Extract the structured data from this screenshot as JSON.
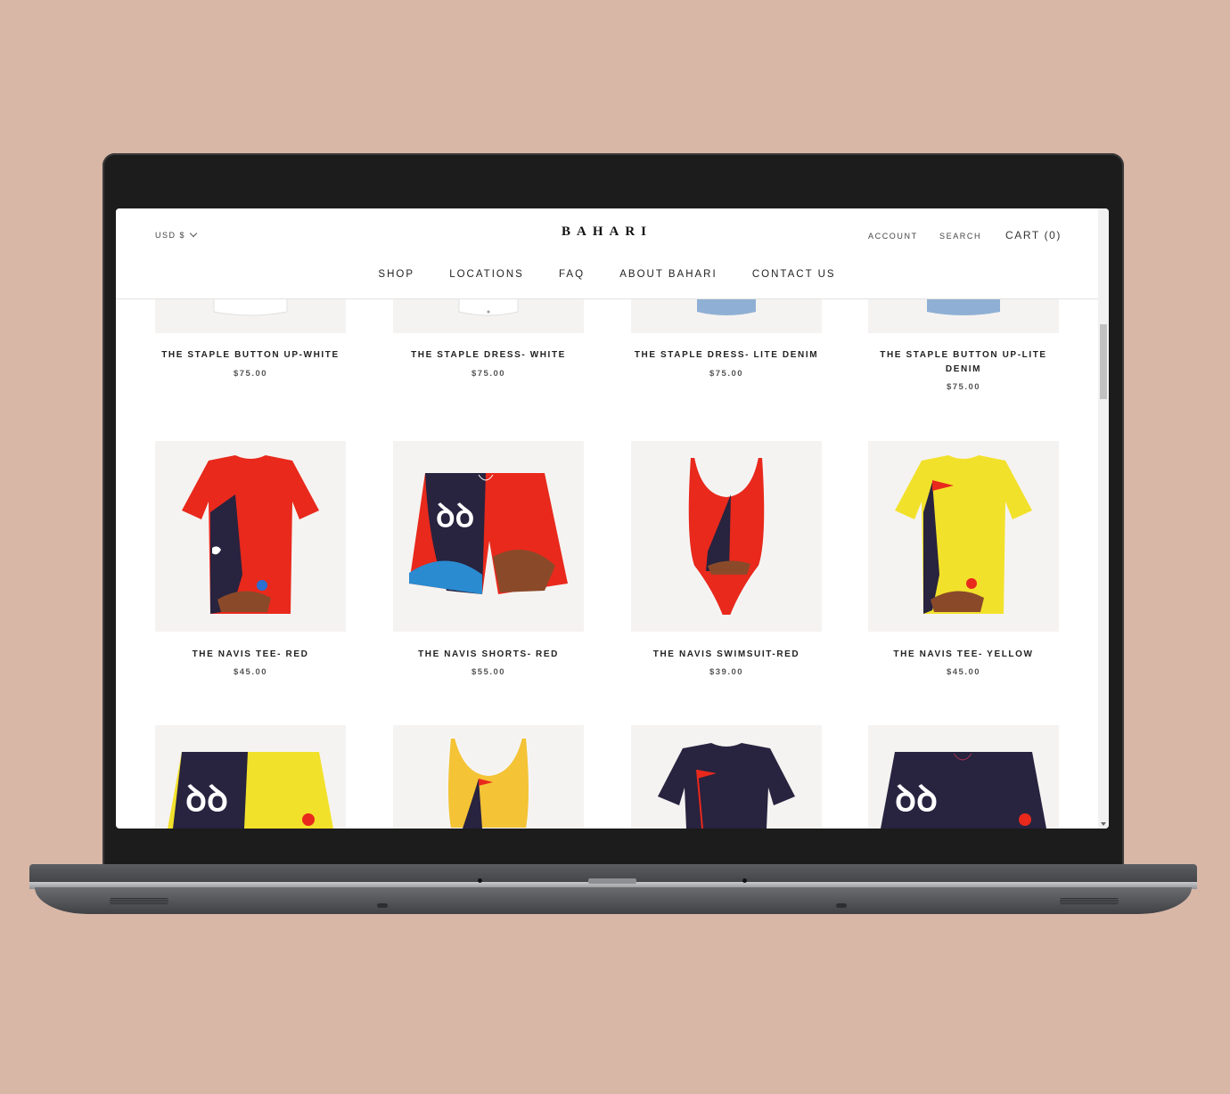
{
  "header": {
    "currency": "USD $",
    "logo": "BAHARI",
    "account": "ACCOUNT",
    "search": "SEARCH",
    "cart": "CART (0)"
  },
  "nav": [
    "SHOP",
    "LOCATIONS",
    "FAQ",
    "ABOUT BAHARI",
    "CONTACT US"
  ],
  "products_row1": [
    {
      "name": "THE STAPLE BUTTON UP-WHITE",
      "price": "$75.00"
    },
    {
      "name": "THE STAPLE DRESS- WHITE",
      "price": "$75.00"
    },
    {
      "name": "THE STAPLE DRESS- LITE DENIM",
      "price": "$75.00"
    },
    {
      "name": "THE STAPLE BUTTON UP-LITE DENIM",
      "price": "$75.00"
    }
  ],
  "products_row2": [
    {
      "name": "THE NAVIS TEE- RED",
      "price": "$45.00"
    },
    {
      "name": "THE NAVIS SHORTS- RED",
      "price": "$55.00"
    },
    {
      "name": "THE NAVIS SWIMSUIT-RED",
      "price": "$39.00"
    },
    {
      "name": "THE NAVIS TEE- YELLOW",
      "price": "$45.00"
    }
  ],
  "colors": {
    "background": "#d8b7a7",
    "navis_red": "#e8291c",
    "navis_yellow": "#f2e12b",
    "navy": "#28233f"
  }
}
